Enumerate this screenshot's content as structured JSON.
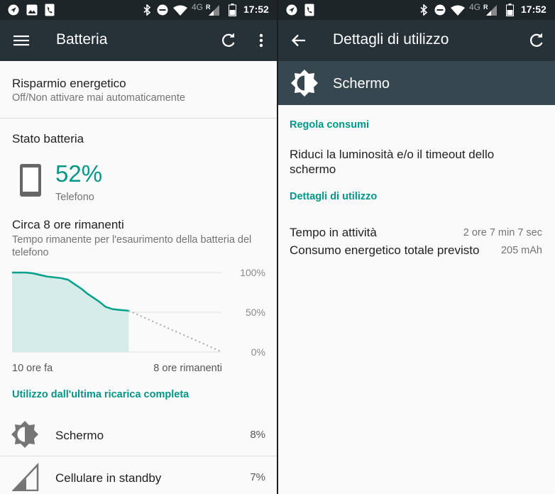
{
  "status_bar": {
    "time": "17:52",
    "network": "4G",
    "roaming": "R"
  },
  "left": {
    "app_bar": {
      "title": "Batteria"
    },
    "power_saver": {
      "title": "Risparmio energetico",
      "subtitle": "Off/Non attivare mai automaticamente"
    },
    "battery_status": {
      "heading": "Stato batteria",
      "percent": "52%",
      "device": "Telefono",
      "remaining_title": "Circa 8 ore rimanenti",
      "remaining_desc": "Tempo rimanente per l'esaurimento della batteria del telefono"
    },
    "chart_data": {
      "type": "area",
      "y_ticks": [
        "100%",
        "50%",
        "0%"
      ],
      "x_start_label": "10 ore fa",
      "x_end_label": "8 ore rimanenti",
      "ylim": [
        0,
        100
      ],
      "xlim": [
        -10,
        8
      ],
      "history": {
        "x": [
          -10,
          -9.4,
          -8.8,
          -8.2,
          -7.6,
          -7.0,
          -6.4,
          -5.8,
          -5.2,
          -4.6,
          -4.0,
          -3.6,
          -3.0,
          -2.5,
          -2.0,
          -1.4,
          -0.8,
          0
        ],
        "y": [
          100,
          100,
          100,
          99,
          97,
          95,
          94,
          93,
          91,
          85,
          79,
          74,
          68,
          63,
          57,
          54,
          53,
          52
        ]
      },
      "projection": {
        "x": [
          0,
          8
        ],
        "y": [
          52,
          0
        ]
      },
      "colors": {
        "line": "#00a08a",
        "fill": "#d5ece8",
        "projection": "#aaaaaa",
        "grid": "#dddddd"
      }
    },
    "usage": {
      "heading": "Utilizzo dall'ultima ricarica completa",
      "items": [
        {
          "label": "Schermo",
          "value": "8%",
          "icon": "brightness-icon"
        },
        {
          "label": "Cellulare in standby",
          "value": "7%",
          "icon": "cell-signal-icon"
        }
      ]
    }
  },
  "right": {
    "app_bar": {
      "title": "Dettagli di utilizzo"
    },
    "header": {
      "title": "Schermo",
      "icon": "brightness-icon"
    },
    "adjust": {
      "heading": "Regola consumi",
      "text": "Riduci la luminosità e/o il timeout dello schermo"
    },
    "details": {
      "heading": "Dettagli di utilizzo",
      "rows": [
        {
          "label": "Tempo in attività",
          "value": "2 ore 7 min 7 sec"
        },
        {
          "label": "Consumo energetico totale previsto",
          "value": "205 mAh"
        }
      ]
    }
  },
  "colors": {
    "accent": "#009688",
    "app_bar": "#263238",
    "status_bar": "#1d2529",
    "header": "#37474f"
  }
}
